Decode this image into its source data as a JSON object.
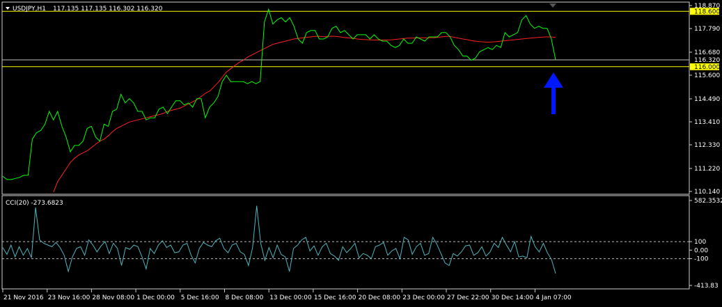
{
  "header": {
    "symbol": "USDJPY,H1",
    "ohlc": "117.135 117.135 116.302 116.320"
  },
  "indicator": {
    "label": "CCI(20) -273.6823"
  },
  "colors": {
    "background": "#000000",
    "frame": "#d0d0d0",
    "price": "#00ff00",
    "ma": "#ff2020",
    "cci": "#4fb6bf",
    "level": "#ffff00",
    "current": "#c0c0c0",
    "arrow": "#0018ff",
    "level_label": "#ffff00",
    "current_label": "#ffffff"
  },
  "chart_data": [
    {
      "type": "line",
      "series": [
        {
          "values": [
            110.85,
            110.7,
            110.7,
            110.75,
            110.8,
            110.9,
            110.9,
            112.6,
            112.9,
            113.0,
            113.3,
            113.9,
            113.5,
            113.9,
            113.2,
            112.7,
            112.0,
            112.3,
            112.3,
            112.5,
            113.1,
            113.2,
            112.7,
            112.5,
            113.3,
            113.2,
            113.9,
            114.0,
            114.7,
            114.3,
            114.5,
            114.3,
            113.9,
            113.9,
            113.5,
            113.6,
            113.6,
            114.0,
            114.1,
            113.8,
            114.1,
            114.4,
            114.4,
            114.2,
            114.3,
            114.1,
            114.5,
            114.5,
            113.6,
            114.1,
            114.3,
            114.6,
            115.3,
            115.6,
            115.3,
            115.3,
            115.3,
            115.3,
            115.2,
            115.3,
            115.2,
            115.3,
            118.1,
            118.7,
            118.0,
            118.2,
            118.3,
            118.1,
            118.3,
            117.9,
            117.3,
            117.1,
            117.6,
            117.7,
            117.7,
            117.3,
            117.3,
            117.4,
            117.8,
            117.9,
            117.6,
            117.7,
            117.5,
            117.3,
            117.5,
            117.5,
            117.5,
            117.3,
            117.5,
            117.3,
            117.2,
            117.2,
            117.0,
            116.9,
            117.0,
            117.3,
            117.1,
            117.1,
            117.4,
            117.3,
            117.2,
            117.4,
            117.4,
            117.4,
            117.6,
            117.6,
            117.4,
            117.0,
            116.8,
            116.5,
            116.5,
            116.3,
            116.4,
            116.7,
            116.8,
            116.9,
            116.8,
            117.0,
            116.9,
            117.6,
            117.4,
            117.5,
            117.6,
            118.2,
            118.4,
            118.0,
            117.8,
            117.9,
            117.8,
            117.8,
            117.3,
            116.32
          ]
        },
        {
          "values": [
            null,
            null,
            null,
            null,
            null,
            null,
            null,
            null,
            null,
            null,
            null,
            null,
            110.1,
            110.6,
            110.9,
            111.2,
            111.5,
            111.7,
            111.85,
            111.95,
            112.05,
            112.2,
            112.35,
            112.5,
            112.6,
            112.75,
            112.95,
            113.1,
            113.2,
            113.3,
            113.4,
            113.45,
            113.5,
            113.55,
            113.6,
            113.65,
            113.7,
            113.75,
            113.8,
            113.9,
            113.95,
            114.0,
            114.05,
            114.15,
            114.25,
            114.35,
            114.45,
            114.6,
            114.75,
            114.85,
            115.05,
            115.25,
            115.5,
            115.75,
            115.9,
            116.05,
            116.2,
            116.3,
            116.45,
            116.55,
            116.65,
            116.75,
            116.85,
            116.95,
            117.05,
            117.1,
            117.15,
            117.2,
            117.25,
            117.3,
            117.33,
            117.35,
            117.38,
            117.4,
            117.42,
            117.42,
            117.41,
            117.42,
            117.43,
            117.42,
            117.4,
            117.37,
            117.35,
            117.33,
            117.3,
            117.28,
            117.27,
            117.26,
            117.25,
            117.25,
            117.25,
            117.25,
            117.26,
            117.28,
            117.3,
            117.32,
            117.34,
            117.34,
            117.35,
            117.36,
            117.36,
            117.36,
            117.36,
            117.38,
            117.4,
            117.42,
            117.42,
            117.38,
            117.34,
            117.3,
            117.27,
            117.23,
            117.2,
            117.18,
            117.16,
            117.15,
            117.16,
            117.18,
            117.2,
            117.22,
            117.24,
            117.26,
            117.28,
            117.3,
            117.32,
            117.34,
            117.36,
            117.38,
            117.39,
            117.4,
            117.4,
            117.38
          ]
        }
      ],
      "ylim": [
        110.14,
        118.87
      ],
      "ytick_labels": [
        "118.870",
        "117.790",
        "116.680",
        "115.600",
        "114.490",
        "113.410",
        "112.330",
        "111.220",
        "110.140"
      ],
      "yticks": [
        118.87,
        117.79,
        116.68,
        115.6,
        114.49,
        113.41,
        112.33,
        111.22,
        110.14
      ],
      "levels": [
        {
          "value": 118.6,
          "label": "118.600"
        },
        {
          "value": 116.0,
          "label": "116.000"
        }
      ],
      "current": {
        "value": 116.32,
        "label": "116.320"
      }
    },
    {
      "type": "line",
      "series": [
        {
          "values": [
            30,
            -50,
            60,
            -80,
            40,
            -60,
            20,
            -90,
            500,
            120,
            80,
            60,
            40,
            90,
            30,
            -60,
            -250,
            -80,
            20,
            40,
            -60,
            120,
            60,
            -20,
            50,
            100,
            -40,
            80,
            20,
            -180,
            30,
            10,
            60,
            40,
            -80,
            -220,
            20,
            -40,
            60,
            110,
            30,
            60,
            -30,
            -20,
            60,
            80,
            -60,
            -150,
            20,
            90,
            60,
            40,
            110,
            140,
            20,
            -30,
            60,
            80,
            -20,
            -50,
            -180,
            30,
            520,
            80,
            -120,
            30,
            -90,
            60,
            -50,
            -80,
            -250,
            20,
            60,
            120,
            150,
            -10,
            50,
            -60,
            40,
            80,
            -40,
            -70,
            -120,
            40,
            -30,
            20,
            80,
            -90,
            -40,
            -60,
            -100,
            40,
            60,
            90,
            -60,
            -10,
            20,
            -100,
            150,
            120,
            -50,
            40,
            80,
            -60,
            -40,
            150,
            70,
            -40,
            -150,
            -180,
            -40,
            -70,
            -20,
            50,
            60,
            -60,
            -30,
            40,
            -70,
            -20,
            80,
            30,
            150,
            60,
            -20,
            100,
            -80,
            -70,
            -90,
            160,
            40,
            -20,
            80,
            -30,
            -110,
            -273.68
          ]
        }
      ],
      "ylim": [
        -413.83,
        582.35
      ],
      "ytick_labels": [
        "582.3532",
        "100",
        "0.00",
        "-100",
        "-413.83"
      ],
      "yticks": [
        582.35,
        100,
        0,
        -100,
        -413.83
      ],
      "reference_lines": [
        100,
        -100
      ]
    }
  ],
  "xaxis": {
    "labels": [
      "21 Nov 2016",
      "23 Nov 16:00",
      "28 Nov 08:00",
      "1 Dec 00:00",
      "5 Dec 16:00",
      "8 Dec 08:00",
      "13 Dec 00:00",
      "15 Dec 16:00",
      "20 Dec 08:00",
      "23 Dec 00:00",
      "27 Dec 22:00",
      "30 Dec 14:00",
      "4 Jan 07:00"
    ]
  }
}
